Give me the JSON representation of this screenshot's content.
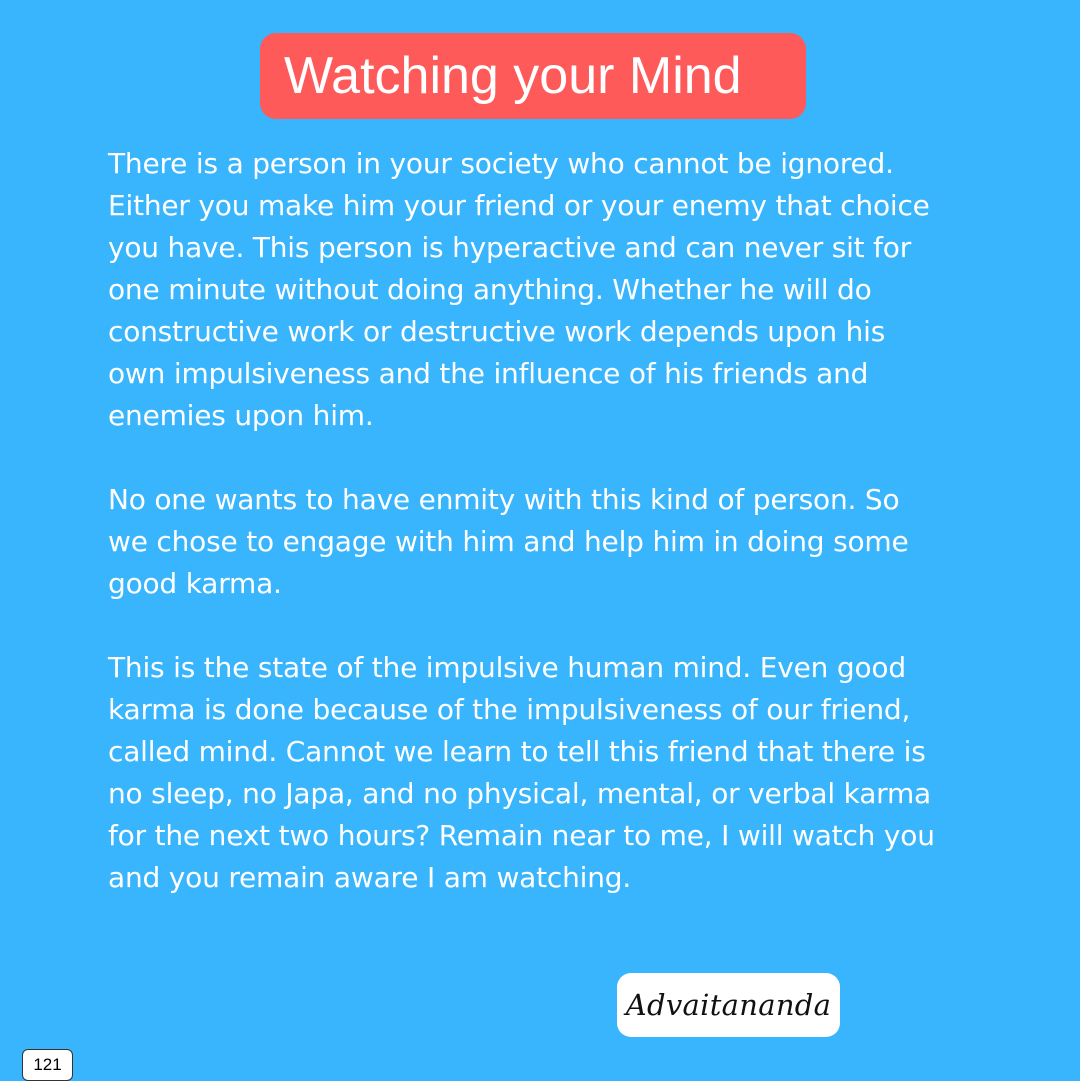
{
  "title": "Watching your Mind",
  "paragraphs": [
    {
      "lines": [
        "There is a person in your society who cannot be ignored.",
        "Either you make him your friend or your enemy that choice",
        "you have. This person is hyperactive and can never sit for",
        "one minute without doing anything. Whether he will do",
        "constructive work or destructive work depends upon his",
        "own impulsiveness and the influence of his friends and",
        "enemies upon him."
      ]
    },
    {
      "lines": [
        "No one wants to have enmity with this kind of person. So",
        "we chose to engage with him and help him in doing some",
        "good karma."
      ]
    },
    {
      "lines": [
        "This is the state of the impulsive human mind. Even good",
        "karma is done because of the impulsiveness of our friend,",
        "called mind. Cannot we learn to tell this friend that there is",
        "no sleep, no Japa, and no physical, mental, or verbal karma",
        "for the next two hours? Remain near to me, I will watch you",
        "and you remain aware I am watching."
      ]
    }
  ],
  "signature": "Advaitananda",
  "page_number": "121",
  "colors": {
    "background": "#38b5fd",
    "title_background": "#ff5a5a",
    "text": "#ffffff"
  }
}
